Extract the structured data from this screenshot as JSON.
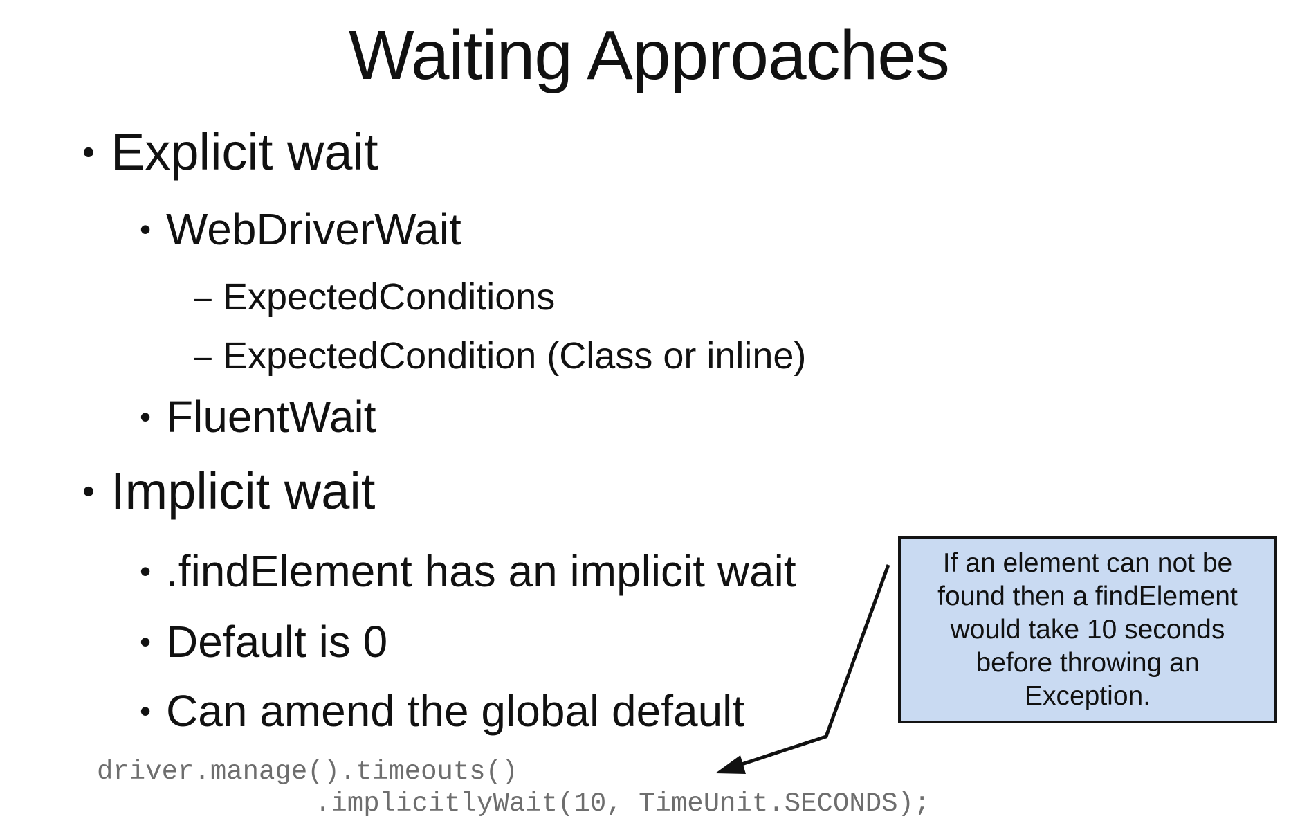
{
  "title": "Waiting Approaches",
  "bullets": {
    "explicit": {
      "label": "Explicit wait",
      "webdriverwait": "WebDriverWait",
      "expected_conditions": "ExpectedConditions",
      "expected_condition": "ExpectedCondition (Class or inline)",
      "fluentwait": "FluentWait"
    },
    "implicit": {
      "label": "Implicit wait",
      "find_element": ".findElement has an implicit wait",
      "default": "Default is 0",
      "amend": "Can amend the global default"
    },
    "bullet_symbol": "•",
    "dash_symbol": "–"
  },
  "code": {
    "line1": "driver.manage().timeouts()",
    "line2": ".implicitlyWait(10, TimeUnit.SECONDS);"
  },
  "callout": {
    "text": "If an element can not be found then a findElement would take 10 seconds before throwing an Exception."
  },
  "colors": {
    "callout_background": "#c9daf2",
    "code_text": "#6e6e6e",
    "text": "#111111"
  }
}
